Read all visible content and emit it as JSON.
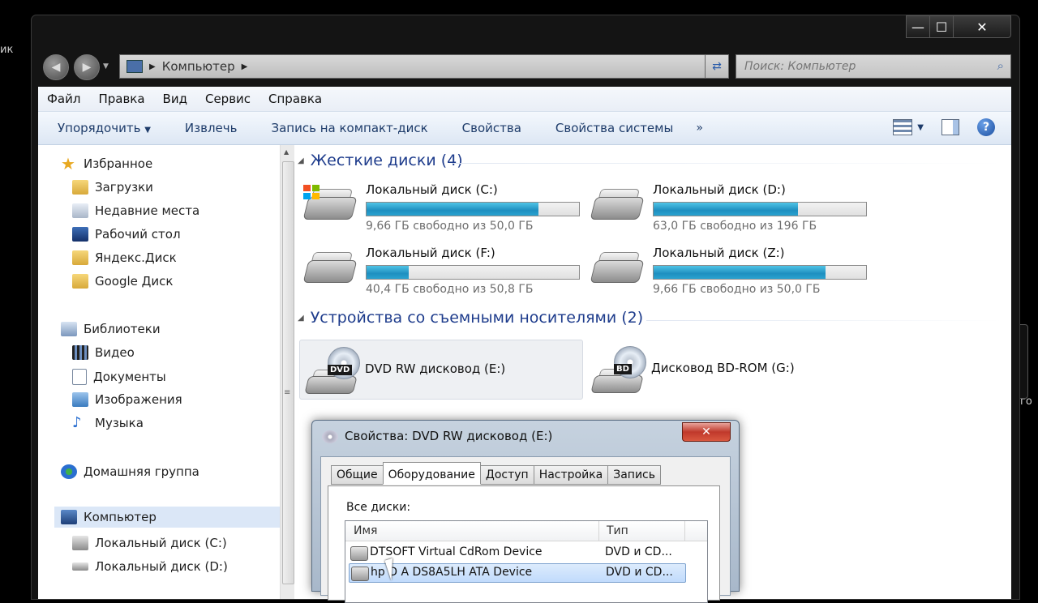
{
  "desktop": {
    "left_text": "ик",
    "right_text": "го"
  },
  "window": {
    "address": {
      "crumbs": [
        "Компьютер"
      ]
    },
    "search": {
      "placeholder": "Поиск: Компьютер"
    },
    "menu": [
      "Файл",
      "Правка",
      "Вид",
      "Сервис",
      "Справка"
    ],
    "toolbar": {
      "organize": "Упорядочить",
      "eject": "Извлечь",
      "burn": "Запись на компакт-диск",
      "properties": "Свойства",
      "system_properties": "Свойства системы",
      "more": "»"
    },
    "nav": {
      "favorites": "Избранное",
      "downloads": "Загрузки",
      "recent": "Недавние места",
      "desktop": "Рабочий стол",
      "yandex": "Яндекс.Диск",
      "google": "Google Диск",
      "libraries": "Библиотеки",
      "video": "Видео",
      "documents": "Документы",
      "images": "Изображения",
      "music": "Музыка",
      "homegroup": "Домашняя группа",
      "computer": "Компьютер",
      "disk_c": "Локальный диск (C:)",
      "disk_d": "Локальный диск (D:)"
    },
    "hard_drives": {
      "header": "Жесткие диски (4)",
      "items": [
        {
          "name": "Локальный диск (C:)",
          "free": "9,66 ГБ свободно из 50,0 ГБ",
          "used_fraction": 0.81
        },
        {
          "name": "Локальный диск (D:)",
          "free": "63,0 ГБ свободно из 196 ГБ",
          "used_fraction": 0.68
        },
        {
          "name": "Локальный диск (F:)",
          "free": "40,4 ГБ свободно из 50,8 ГБ",
          "used_fraction": 0.2
        },
        {
          "name": "Локальный диск (Z:)",
          "free": "9,66 ГБ свободно из 50,0 ГБ",
          "used_fraction": 0.81
        }
      ]
    },
    "removable": {
      "header": "Устройства со съемными носителями (2)",
      "items": [
        {
          "name": "DVD RW дисковод (E:)",
          "badge": "DVD"
        },
        {
          "name": "Дисковод BD-ROM (G:)",
          "badge": "BD"
        }
      ]
    }
  },
  "dialog": {
    "title": "Свойства: DVD RW дисковод (E:)",
    "tabs": [
      "Общие",
      "Оборудование",
      "Доступ",
      "Настройка",
      "Запись"
    ],
    "active_tab": "Оборудование",
    "all_disks_label": "Все диски:",
    "columns": [
      "Имя",
      "Тип"
    ],
    "rows": [
      {
        "name": "DTSOFT Virtual CdRom Device",
        "type": "DVD и CD..."
      },
      {
        "name": "hp    D A  DS8A5LH ATA Device",
        "type": "DVD и CD..."
      }
    ]
  }
}
